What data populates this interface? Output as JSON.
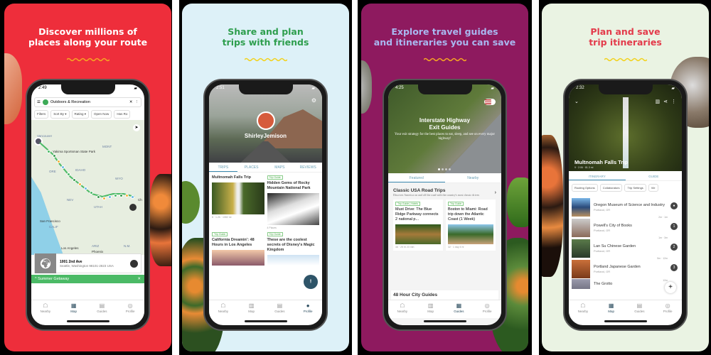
{
  "panels": [
    {
      "headline_line1": "Discover millions of",
      "headline_line2": "places along your route",
      "headline_color": "#ffffff",
      "bg_color": "#ee2e3b",
      "wave_color": "#f6a623",
      "phone": {
        "time": "2:49",
        "search_value": "Outdoors & Recreation",
        "menu_icon": "hamburger-icon",
        "clear_icon": "close-icon",
        "more_icon": "kebab-icon",
        "chips": [
          "Filters",
          "Sort By ▾",
          "Rating ▾",
          "Open Now",
          "Has Ro"
        ],
        "map_labels": [
          "Vancouver",
          "Yakima Sportsman State Park",
          "MONT",
          "ORE",
          "IDAHO",
          "WYO",
          "NEV",
          "UTAH",
          "San Francisco",
          "CALIF",
          "Los Angeles",
          "ARIZ",
          "Phoenix",
          "N.M.",
          "Ch"
        ],
        "place_card": {
          "title": "1001 2nd Ave",
          "subtitle": "Seattle, Washington 98101-2823 USA"
        },
        "trip_bar": {
          "label": "Summer Getaway",
          "close": "✕",
          "expand": "^"
        },
        "tabs": [
          "Nearby",
          "Map",
          "Guides",
          "Profile"
        ],
        "active_tab": "Map"
      }
    },
    {
      "headline_line1": "Share and plan",
      "headline_line2": "trips with friends",
      "headline_color": "#2e9e4e",
      "bg_color": "#ddf1f8",
      "wave_color": "#f2d21c",
      "phone": {
        "time": "2:51",
        "username": "ShirleyJemison",
        "profile_tabs": [
          "TRIPS",
          "PLACES",
          "MAPS",
          "REVIEWS"
        ],
        "active_profile_tab": "TRIPS",
        "cards": [
          {
            "tag": "",
            "title": "Multnomah Falls Trip",
            "meta": "8 · 1.2h · 1082 mi"
          },
          {
            "tag": "Trip Guide",
            "title": "Hidden Gems of Rocky Mountain National Park",
            "meta": "4 Places"
          },
          {
            "tag": "Trip Guide",
            "title": "California Dreamin': 48 Hours in Los Angeles",
            "meta": ""
          },
          {
            "tag": "Trip Guide",
            "title": "These are the coolest secrets of Disney's Magic Kingdom",
            "meta": ""
          }
        ],
        "tabs": [
          "Nearby",
          "Map",
          "Guides",
          "Profile"
        ],
        "active_tab": "Profile"
      }
    },
    {
      "headline_line1": "Explore travel guides",
      "headline_line2": "and itineraries you can save",
      "headline_color": "#a9b8f0",
      "bg_color": "#8e1a5f",
      "wave_color": "#f6a623",
      "phone": {
        "time": "4:25",
        "hero_title_1": "Interstate Highway",
        "hero_title_2": "Exit Guides",
        "hero_sub": "Your exit strategy for the best places to eat, sleep, and see on every major highway!",
        "guide_tabs": [
          "Featured",
          "Nearby"
        ],
        "active_guide_tab": "Featured",
        "section1": {
          "title": "Classic USA Road Trips",
          "subtitle": "Discover America on and off the road with the country's most classic drives",
          "cards": [
            {
              "tags": "Trip Guide | Hotels",
              "title": "Must Drive: The Blue Ridge Parkway connects 2 national p...",
              "meta": "46 · 25 hr 23 min"
            },
            {
              "tags": "Trip Guide",
              "title": "Boston to Miami: Road trip down the Atlantic Coast (1 Week)",
              "meta": "32 · 1 day 4 hr"
            }
          ]
        },
        "section2": {
          "title": "48 Hour City Guides"
        },
        "tabs": [
          "Nearby",
          "Map",
          "Guides",
          "Profile"
        ],
        "active_tab": "Guides"
      }
    },
    {
      "headline_line1": "Plan and save",
      "headline_line2": "trip itineraries",
      "headline_color": "#e33b4b",
      "bg_color": "#eaf3e3",
      "wave_color": "#f2d21c",
      "phone": {
        "time": "2:32",
        "trip_title": "Multnomah Falls Trip",
        "trip_meta": "9 · 2:06 · 81.3 mi",
        "itin_tabs": [
          "ITINERARY",
          "GUIDE"
        ],
        "active_itin_tab": "ITINERARY",
        "chips": [
          "Routing Options",
          "Collaborators",
          "Trip Settings",
          "Vie"
        ],
        "stops": [
          {
            "name": "Oregon Museum of Science and Industry",
            "city": "Portland, OR",
            "num": "●",
            "dur": ""
          },
          {
            "name": "Powell's City of Books",
            "city": "Portland, OR",
            "num": "1",
            "dur": "2m · 1m"
          },
          {
            "name": "Lan Su Chinese Garden",
            "city": "Portland, OR",
            "num": "2",
            "dur": "1m · 3m"
          },
          {
            "name": "Portland Japanese Garden",
            "city": "Portland, OR",
            "num": "3",
            "dur": "5m · 12m"
          },
          {
            "name": "The Grotto",
            "city": "",
            "num": "4",
            "dur": "12m"
          }
        ],
        "add_label": "+",
        "tabs": [
          "Nearby",
          "Map",
          "Guides",
          "Profile"
        ],
        "active_tab": "Map"
      }
    }
  ]
}
